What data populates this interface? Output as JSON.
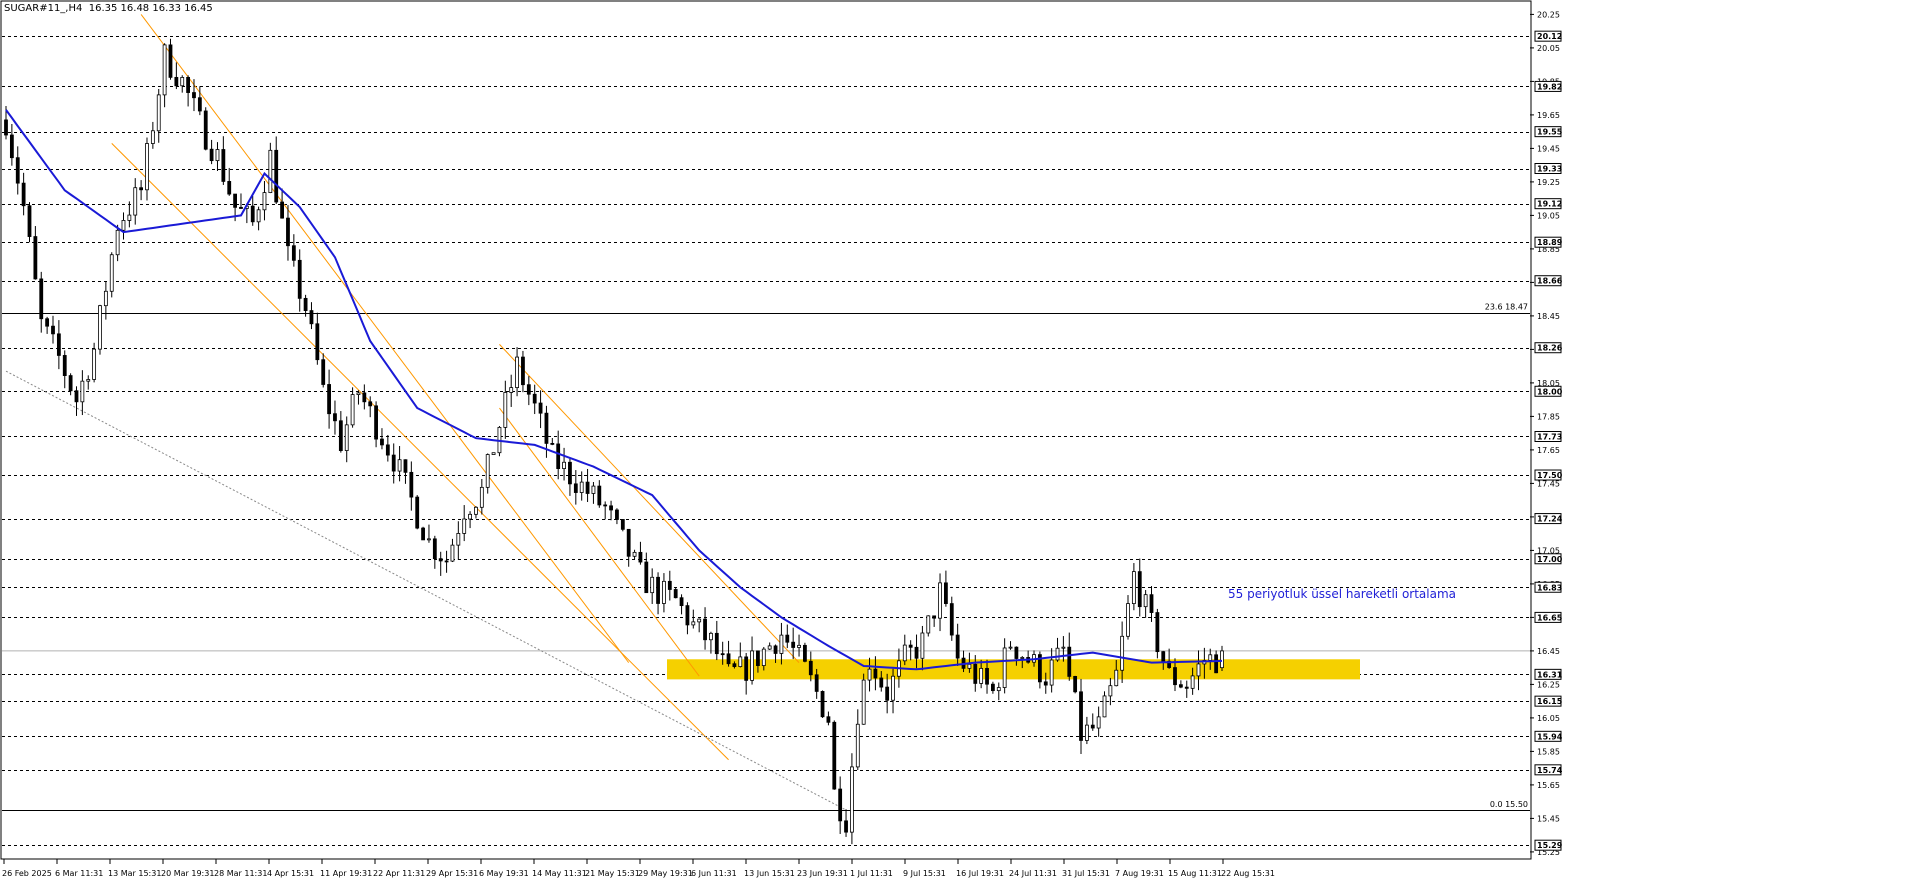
{
  "header": {
    "symbol": "SUGAR#11_,H4",
    "ohlc": "16.35 16.48 16.33 16.45"
  },
  "annotations": {
    "ema_label": "55 periyotluk üssel hareketli ortalama",
    "fib_236": "23.6 18.47",
    "fib_0": "0.0 15.50"
  },
  "colors": {
    "candles": "#000000",
    "ema": "#1a1ad6",
    "channel": "#ff9800",
    "support_zone": "#f5d000",
    "gridline": "#000000",
    "fib": "#000000"
  },
  "chart_data": {
    "type": "candlestick",
    "symbol": "SUGAR#11_,H4",
    "timeframe": "H4",
    "last_ohlc": {
      "open": 16.35,
      "high": 16.48,
      "low": 16.33,
      "close": 16.45
    },
    "ylim": [
      15.29,
      20.25
    ],
    "y_tick_labels": [
      "20.25",
      "20.05",
      "19.85",
      "19.65",
      "19.45",
      "19.25",
      "19.05",
      "18.85",
      "18.65",
      "18.45",
      "18.25",
      "18.05",
      "17.85",
      "17.65",
      "17.45",
      "17.25",
      "17.05",
      "16.85",
      "16.65",
      "16.45",
      "16.25",
      "16.05",
      "15.85",
      "15.65",
      "15.45",
      "15.25"
    ],
    "x_tick_labels": [
      "26 Feb 2025",
      "6 Mar 11:31",
      "13 Mar 15:31",
      "20 Mar 19:31",
      "28 Mar 11:31",
      "4 Apr 15:31",
      "11 Apr 19:31",
      "22 Apr 11:31",
      "29 Apr 15:31",
      "6 May 19:31",
      "14 May 11:31",
      "21 May 15:31",
      "29 May 19:31",
      "6 Jun 11:31",
      "13 Jun 15:31",
      "23 Jun 19:31",
      "1 Jul 11:31",
      "9 Jul 15:31",
      "16 Jul 19:31",
      "24 Jul 11:31",
      "31 Jul 15:31",
      "7 Aug 19:31",
      "15 Aug 11:31",
      "22 Aug 15:31"
    ],
    "horizontal_levels": [
      "20.12",
      "19.82",
      "19.55",
      "19.33",
      "19.12",
      "18.89",
      "18.66",
      "18.26",
      "18.00",
      "17.73",
      "17.50",
      "17.24",
      "17.00",
      "16.83",
      "16.65",
      "16.31",
      "16.15",
      "15.94",
      "15.74",
      "15.29"
    ],
    "price_path": [
      [
        0,
        19.62
      ],
      [
        3,
        19.1
      ],
      [
        6,
        18.4
      ],
      [
        9,
        18.2
      ],
      [
        12,
        17.95
      ],
      [
        15,
        18.25
      ],
      [
        19,
        19.0
      ],
      [
        23,
        19.2
      ],
      [
        27,
        20.0
      ],
      [
        30,
        19.85
      ],
      [
        33,
        19.6
      ],
      [
        36,
        19.4
      ],
      [
        39,
        19.1
      ],
      [
        42,
        19.0
      ],
      [
        45,
        19.4
      ],
      [
        48,
        18.8
      ],
      [
        51,
        18.5
      ],
      [
        54,
        18.0
      ],
      [
        57,
        17.7
      ],
      [
        60,
        18.0
      ],
      [
        63,
        17.8
      ],
      [
        66,
        17.6
      ],
      [
        69,
        17.35
      ],
      [
        72,
        17.1
      ],
      [
        75,
        17.0
      ],
      [
        78,
        17.3
      ],
      [
        81,
        17.4
      ],
      [
        84,
        17.8
      ],
      [
        87,
        18.15
      ],
      [
        90,
        17.9
      ],
      [
        93,
        17.6
      ],
      [
        96,
        17.5
      ],
      [
        99,
        17.4
      ],
      [
        102,
        17.3
      ],
      [
        105,
        17.1
      ],
      [
        108,
        16.9
      ],
      [
        111,
        16.8
      ],
      [
        114,
        16.75
      ],
      [
        117,
        16.6
      ],
      [
        120,
        16.5
      ],
      [
        123,
        16.3
      ],
      [
        126,
        16.35
      ],
      [
        129,
        16.45
      ],
      [
        132,
        16.55
      ],
      [
        135,
        16.4
      ],
      [
        138,
        16.2
      ],
      [
        140,
        16.05
      ],
      [
        141,
        15.6
      ],
      [
        143,
        15.45
      ],
      [
        145,
        16.1
      ],
      [
        147,
        16.4
      ],
      [
        150,
        16.2
      ],
      [
        153,
        16.4
      ],
      [
        156,
        16.5
      ],
      [
        159,
        16.8
      ],
      [
        162,
        16.4
      ],
      [
        165,
        16.3
      ],
      [
        168,
        16.2
      ],
      [
        171,
        16.5
      ],
      [
        174,
        16.4
      ],
      [
        177,
        16.3
      ],
      [
        180,
        16.45
      ],
      [
        183,
        15.95
      ],
      [
        186,
        16.0
      ],
      [
        189,
        16.3
      ],
      [
        192,
        16.9
      ],
      [
        195,
        16.6
      ],
      [
        198,
        16.3
      ],
      [
        201,
        16.25
      ],
      [
        204,
        16.4
      ],
      [
        207,
        16.4
      ]
    ],
    "ema55_path": [
      [
        0,
        19.68
      ],
      [
        10,
        19.2
      ],
      [
        20,
        18.95
      ],
      [
        30,
        19.0
      ],
      [
        40,
        19.05
      ],
      [
        44,
        19.3
      ],
      [
        50,
        19.1
      ],
      [
        56,
        18.8
      ],
      [
        62,
        18.3
      ],
      [
        70,
        17.9
      ],
      [
        80,
        17.72
      ],
      [
        90,
        17.68
      ],
      [
        100,
        17.55
      ],
      [
        110,
        17.38
      ],
      [
        118,
        17.05
      ],
      [
        125,
        16.83
      ],
      [
        132,
        16.65
      ],
      [
        140,
        16.48
      ],
      [
        146,
        16.36
      ],
      [
        155,
        16.34
      ],
      [
        165,
        16.38
      ],
      [
        175,
        16.4
      ],
      [
        185,
        16.44
      ],
      [
        195,
        16.38
      ],
      [
        207,
        16.39
      ]
    ],
    "support_zone": {
      "low": 16.28,
      "high": 16.4
    },
    "trend_channels": [
      {
        "upper": [
          [
            23,
            20.25
          ],
          [
            106,
            16.38
          ]
        ],
        "lower": [
          [
            18,
            19.48
          ],
          [
            123,
            15.8
          ]
        ]
      },
      {
        "upper": [
          [
            84,
            18.28
          ],
          [
            135,
            16.38
          ]
        ],
        "lower": [
          [
            84,
            17.9
          ],
          [
            118,
            16.3
          ]
        ]
      }
    ],
    "dotted_trendline": [
      [
        0,
        18.12
      ],
      [
        143,
        15.5
      ]
    ],
    "fibonacci": [
      {
        "level": "23.6",
        "price": 18.47
      },
      {
        "level": "0.0",
        "price": 15.5
      }
    ]
  }
}
